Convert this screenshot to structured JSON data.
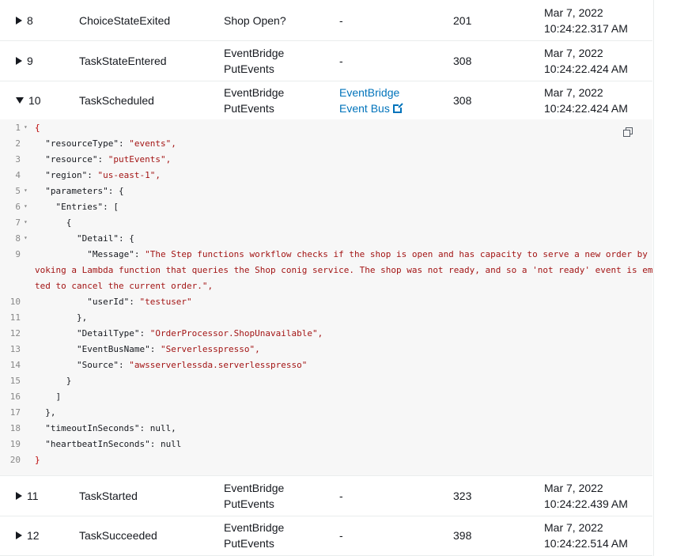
{
  "rows_top": [
    {
      "id": "8",
      "type": "ChoiceStateExited",
      "step": [
        "Shop Open?",
        ""
      ],
      "resource": "-",
      "elapsed": "201",
      "time": [
        "Mar 7, 2022",
        "10:24:22.317 AM"
      ]
    },
    {
      "id": "9",
      "type": "TaskStateEntered",
      "step": [
        "EventBridge",
        "PutEvents"
      ],
      "resource": "-",
      "elapsed": "308",
      "time": [
        "Mar 7, 2022",
        "10:24:22.424 AM"
      ]
    },
    {
      "id": "10",
      "type": "TaskScheduled",
      "step": [
        "EventBridge",
        "PutEvents"
      ],
      "resource_link": [
        "EventBridge",
        "Event Bus"
      ],
      "elapsed": "308",
      "time": [
        "Mar 7, 2022",
        "10:24:22.424 AM"
      ]
    }
  ],
  "code_lines": [
    {
      "n": "1",
      "t": "{"
    },
    {
      "n": "2",
      "t": "  \"resourceType\": \"events\","
    },
    {
      "n": "3",
      "t": "  \"resource\": \"putEvents\","
    },
    {
      "n": "4",
      "t": "  \"region\": \"us-east-1\","
    },
    {
      "n": "5",
      "t": "  \"parameters\": {"
    },
    {
      "n": "6",
      "t": "    \"Entries\": ["
    },
    {
      "n": "7",
      "t": "      {"
    },
    {
      "n": "8",
      "t": "        \"Detail\": {"
    },
    {
      "n": "9",
      "t": "          \"Message\": \"The Step functions workflow checks if the shop is open and has capacity to serve a new order by"
    },
    {
      "n": "",
      "t": "voking a Lambda function that queries the Shop conig service. The shop was not ready, and so a 'not ready' event is em"
    },
    {
      "n": "",
      "t": "ted to cancel the current order.\","
    },
    {
      "n": "10",
      "t": "          \"userId\": \"testuser\""
    },
    {
      "n": "11",
      "t": "        },"
    },
    {
      "n": "12",
      "t": "        \"DetailType\": \"OrderProcessor.ShopUnavailable\","
    },
    {
      "n": "13",
      "t": "        \"EventBusName\": \"Serverlesspresso\","
    },
    {
      "n": "14",
      "t": "        \"Source\": \"awsserverlessda.serverlesspresso\""
    },
    {
      "n": "15",
      "t": "      }"
    },
    {
      "n": "16",
      "t": "    ]"
    },
    {
      "n": "17",
      "t": "  },"
    },
    {
      "n": "18",
      "t": "  \"timeoutInSeconds\": null,"
    },
    {
      "n": "19",
      "t": "  \"heartbeatInSeconds\": null"
    },
    {
      "n": "20",
      "t": "}"
    }
  ],
  "fold_lines": [
    "1",
    "5",
    "6",
    "7",
    "8"
  ],
  "rows_bottom": [
    {
      "id": "11",
      "type": "TaskStarted",
      "step": [
        "EventBridge",
        "PutEvents"
      ],
      "resource": "-",
      "elapsed": "323",
      "time": [
        "Mar 7, 2022",
        "10:24:22.439 AM"
      ]
    },
    {
      "id": "12",
      "type": "TaskSucceeded",
      "step": [
        "EventBridge",
        "PutEvents"
      ],
      "resource": "-",
      "elapsed": "398",
      "time": [
        "Mar 7, 2022",
        "10:24:22.514 AM"
      ]
    }
  ],
  "colors": {
    "link": "#0073bb",
    "string": "#a31515",
    "border": "#eaeded",
    "code_bg": "#f7f7f7"
  },
  "icons": {
    "expand": "caret-right-icon",
    "collapse": "caret-down-icon",
    "external": "external-link-icon",
    "copy": "copy-icon"
  }
}
